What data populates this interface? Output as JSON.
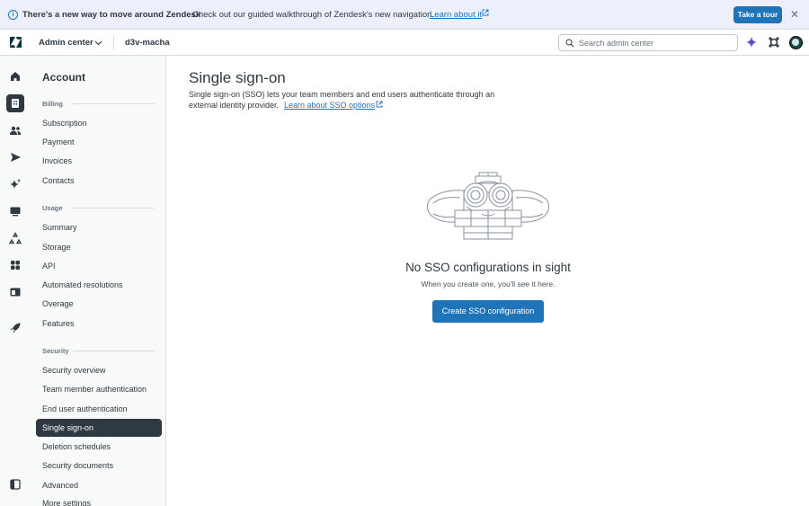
{
  "banner": {
    "title": "There's a new way to move around Zendesk",
    "text": "Check out our guided walkthrough of Zendesk's new navigation.",
    "link": "Learn about it",
    "tour_button": "Take a tour"
  },
  "header": {
    "product": "Admin center",
    "account": "d3v-macha",
    "search_placeholder": "Search admin center"
  },
  "subnav": {
    "title": "Account",
    "groups": [
      {
        "heading": "Billing",
        "items": [
          "Subscription",
          "Payment",
          "Invoices",
          "Contacts"
        ]
      },
      {
        "heading": "Usage",
        "items": [
          "Summary",
          "Storage",
          "API",
          "Automated resolutions",
          "Overage",
          "Features"
        ]
      },
      {
        "heading": "Security",
        "items": [
          "Security overview",
          "Team member authentication",
          "End user authentication",
          "Single sign-on",
          "Deletion schedules",
          "Security documents",
          "Advanced",
          "More settings"
        ]
      }
    ],
    "active_item": "Single sign-on"
  },
  "main": {
    "title": "Single sign-on",
    "description_line1": "Single sign-on (SSO) lets your team members and end users authenticate through an",
    "description_line2": "external identity provider.",
    "description_link": "Learn about SSO options",
    "empty_title": "No SSO configurations in sight",
    "empty_subtitle": "When you create one, you'll see it here.",
    "cta_label": "Create SSO configuration"
  },
  "icons": {
    "rail": [
      "home-icon",
      "account-icon",
      "people-icon",
      "channels-icon",
      "ai-icon",
      "workspaces-icon",
      "objects-icon",
      "apps-icon",
      "integrations-icon",
      "getting-started-icon",
      "collapse-sidebar-icon"
    ],
    "header": [
      "zendesk-logo-icon",
      "chevron-down-icon",
      "search-icon",
      "sparkle-icon",
      "products-icon",
      "avatar"
    ]
  },
  "colors": {
    "accent": "#1f73b7",
    "active_nav": "#2f3941",
    "banner_bg": "#edf0fb"
  }
}
